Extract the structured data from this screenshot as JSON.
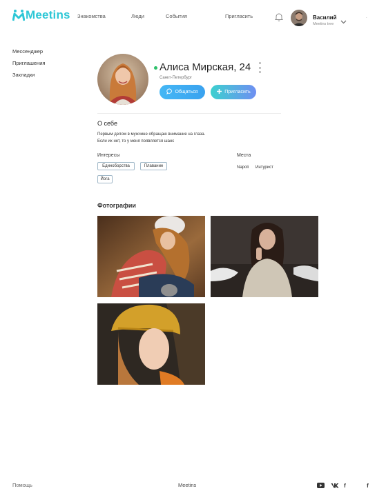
{
  "app": {
    "logo_text": "Meetins",
    "logo_mark": "M",
    "brand_color": "#2ec7d6"
  },
  "nav": {
    "items": [
      {
        "label": "Знакомства"
      },
      {
        "label": "Люди"
      },
      {
        "label": "События"
      },
      {
        "label": "Пригласить"
      }
    ]
  },
  "user": {
    "name": "Василий",
    "sub": "Meetins tree",
    "avatar_icon": "user-avatar"
  },
  "header_extra": ".",
  "sidebar": {
    "items": [
      {
        "label": "Мессенджер"
      },
      {
        "label": "Приглашения"
      },
      {
        "label": "Закладки"
      }
    ]
  },
  "profile": {
    "name": "Алиса Мирская, 24",
    "city": "Санкт-Петербург",
    "online_color": "#2dc06a",
    "chat_button": "Общаться",
    "invite_button": "Пригласить"
  },
  "about": {
    "title": "О себе",
    "line1": "Первым делом в мужчине обращаю внимание на глаза.",
    "line2": "Если их нет, то у меня появляется шанс"
  },
  "interests": {
    "title": "Интересы",
    "tags": [
      "Единоборства",
      "Плавание",
      "Йога"
    ]
  },
  "places": {
    "title": "Места",
    "items": [
      "Napoli",
      "Интурист"
    ]
  },
  "photos": {
    "title": "Фотографии"
  },
  "footer": {
    "help": "Помощь",
    "brand": "Meetins",
    "social": {
      "youtube": "youtube-icon",
      "vk": "vk-icon",
      "facebook": "f",
      "extra": "f"
    }
  }
}
